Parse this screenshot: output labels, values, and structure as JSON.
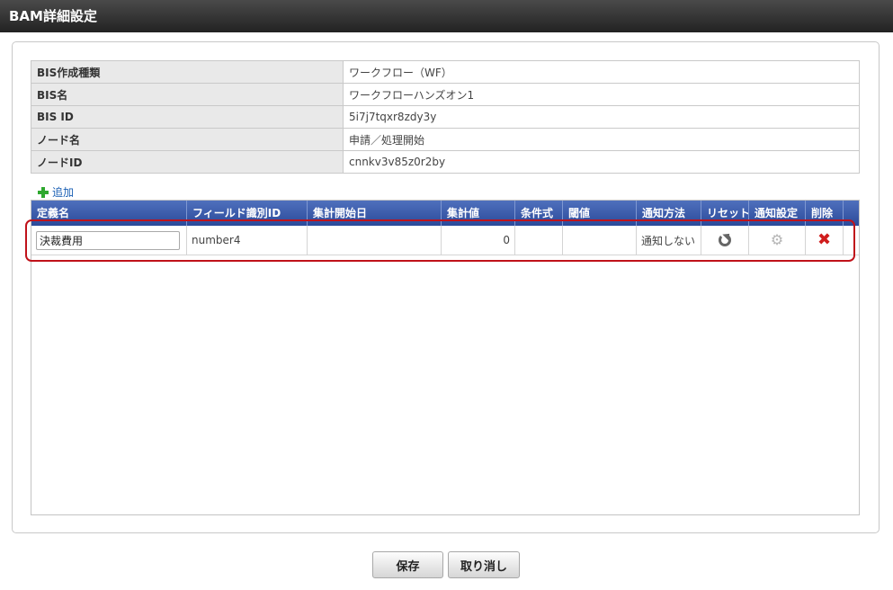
{
  "window": {
    "title": "BAM詳細設定"
  },
  "info": [
    {
      "label": "BIS作成種類",
      "value": "ワークフロー（WF）"
    },
    {
      "label": "BIS名",
      "value": "ワークフローハンズオン1"
    },
    {
      "label": "BIS ID",
      "value": "5i7j7tqxr8zdy3y"
    },
    {
      "label": "ノード名",
      "value": "申請／処理開始"
    },
    {
      "label": "ノードID",
      "value": "cnnkv3v85z0r2by"
    }
  ],
  "add_link": {
    "label": "追加",
    "icon": "plus-icon"
  },
  "grid": {
    "columns": [
      "定義名",
      "フィールド識別ID",
      "集計開始日",
      "集計値",
      "条件式",
      "閾値",
      "通知方法",
      "リセット",
      "通知設定",
      "削除"
    ],
    "rows": [
      {
        "definition_name": "決裁費用",
        "field_id": "number4",
        "start_date": "",
        "aggregate": "0",
        "condition": "",
        "threshold": "",
        "notify_method": "通知しない",
        "reset_icon": "refresh-icon",
        "settings_icon": "gear-icon",
        "delete_icon": "delete-x-icon"
      }
    ]
  },
  "buttons": {
    "save": "保存",
    "cancel": "取り消し"
  },
  "colors": {
    "header_bg": "#3a5aab",
    "highlight": "#c0121a",
    "add_plus": "#2fa82f",
    "delete_x": "#d01d1d"
  }
}
